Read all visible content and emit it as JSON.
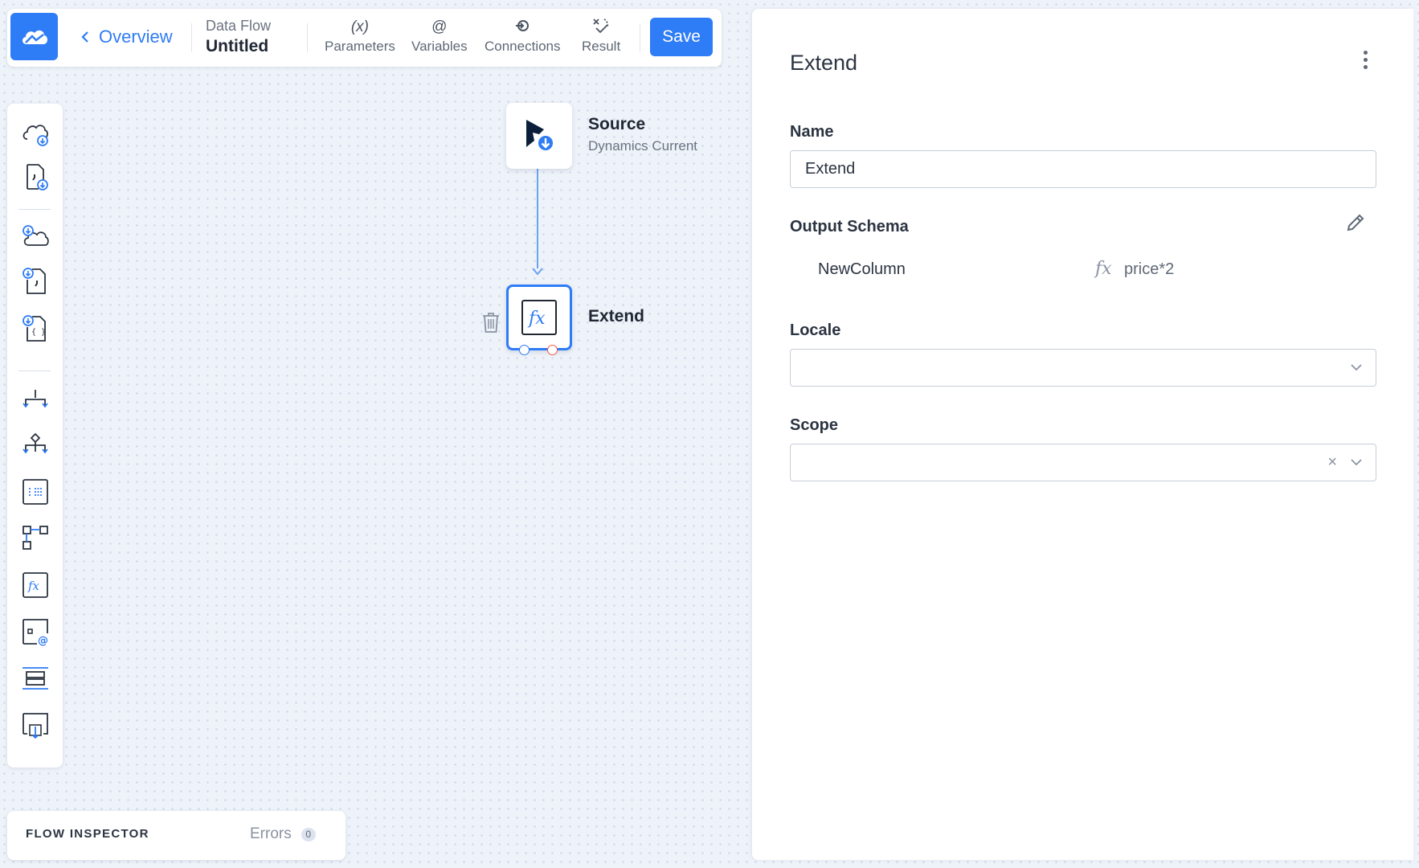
{
  "toolbar": {
    "back_label": "Overview",
    "flow_kind": "Data Flow",
    "flow_name": "Untitled",
    "tools": [
      {
        "icon": "(x)",
        "label": "Parameters"
      },
      {
        "icon": "@",
        "label": "Variables"
      },
      {
        "icon": "connections-icon",
        "label": "Connections"
      },
      {
        "icon": "result-icon",
        "label": "Result"
      }
    ],
    "save_label": "Save"
  },
  "canvas": {
    "nodes": [
      {
        "title": "Source",
        "subtitle": "Dynamics Current",
        "icon": "dynamics-source-icon"
      },
      {
        "title": "Extend",
        "icon": "fx-icon",
        "selected": true
      }
    ]
  },
  "inspector": {
    "title": "FLOW INSPECTOR",
    "errors_label": "Errors",
    "errors_count": "0"
  },
  "panel": {
    "title": "Extend",
    "name_label": "Name",
    "name_value": "Extend",
    "output_schema_label": "Output Schema",
    "schema_rows": [
      {
        "column": "NewColumn",
        "fx": "fx",
        "expression": "price*2"
      }
    ],
    "locale_label": "Locale",
    "locale_value": "",
    "scope_label": "Scope",
    "scope_value": "",
    "scope_clear": "×"
  },
  "colors": {
    "accent": "#2e7cf6",
    "connector": "#6aa3f3",
    "output_port": "#f05a4a"
  }
}
